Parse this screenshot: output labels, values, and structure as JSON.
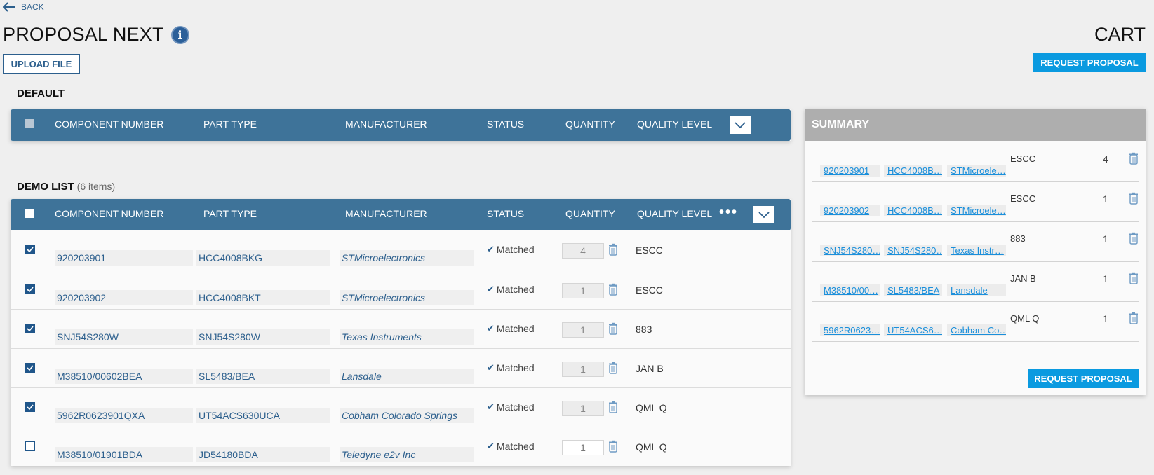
{
  "nav": {
    "back_label": "BACK"
  },
  "header": {
    "title": "PROPOSAL NEXT",
    "info_icon": "info-icon",
    "upload_label": "UPLOAD FILE",
    "cart_title": "CART",
    "request_proposal_label": "REQUEST PROPOSAL"
  },
  "columns": [
    "COMPONENT NUMBER",
    "PART TYPE",
    "MANUFACTURER",
    "STATUS",
    "QUANTITY",
    "QUALITY LEVEL"
  ],
  "default_list": {
    "title": "DEFAULT"
  },
  "demo_list": {
    "title": "DEMO LIST",
    "count_label": "(6 items)",
    "more_label": "•••",
    "rows": [
      {
        "checked": true,
        "component": "920203901",
        "part_type": "HCC4008BKG",
        "manufacturer": "STMicroelectronics",
        "status": "Matched",
        "quantity": "4",
        "quality": "ESCC"
      },
      {
        "checked": true,
        "component": "920203902",
        "part_type": "HCC4008BKT",
        "manufacturer": "STMicroelectronics",
        "status": "Matched",
        "quantity": "1",
        "quality": "ESCC"
      },
      {
        "checked": true,
        "component": "SNJ54S280W",
        "part_type": "SNJ54S280W",
        "manufacturer": "Texas Instruments",
        "status": "Matched",
        "quantity": "1",
        "quality": "883"
      },
      {
        "checked": true,
        "component": "M38510/00602BEA",
        "part_type": "SL5483/BEA",
        "manufacturer": "Lansdale",
        "status": "Matched",
        "quantity": "1",
        "quality": "JAN B"
      },
      {
        "checked": true,
        "component": "5962R0623901QXA",
        "part_type": "UT54ACS630UCA",
        "manufacturer": "Cobham Colorado Springs",
        "status": "Matched",
        "quantity": "1",
        "quality": "QML Q"
      },
      {
        "checked": false,
        "component": "M38510/01901BDA",
        "part_type": "JD54180BDA",
        "manufacturer": "Teledyne e2v Inc",
        "status": "Matched",
        "quantity": "1",
        "quality": "QML Q"
      }
    ]
  },
  "summary": {
    "title": "SUMMARY",
    "request_proposal_label": "REQUEST PROPOSAL",
    "rows": [
      {
        "component": "920203901",
        "part_type": "HCC4008B…",
        "manufacturer": "STMicroele…",
        "quality": "ESCC",
        "quantity": "4"
      },
      {
        "component": "920203902",
        "part_type": "HCC4008B…",
        "manufacturer": "STMicroele…",
        "quality": "ESCC",
        "quantity": "1"
      },
      {
        "component": "SNJ54S280…",
        "part_type": "SNJ54S280…",
        "manufacturer": "Texas Instr…",
        "quality": "883",
        "quantity": "1"
      },
      {
        "component": "M38510/00…",
        "part_type": "SL5483/BEA",
        "manufacturer": "Lansdale",
        "quality": "JAN B",
        "quantity": "1"
      },
      {
        "component": "5962R0623…",
        "part_type": "UT54ACS6…",
        "manufacturer": "Cobham Co…",
        "quality": "QML Q",
        "quantity": "1"
      }
    ]
  },
  "colors": {
    "table_header": "#3e7399",
    "accent_button": "#0a9ae0",
    "link_text": "#2c5f8d",
    "summary_header": "#aeaeae"
  }
}
